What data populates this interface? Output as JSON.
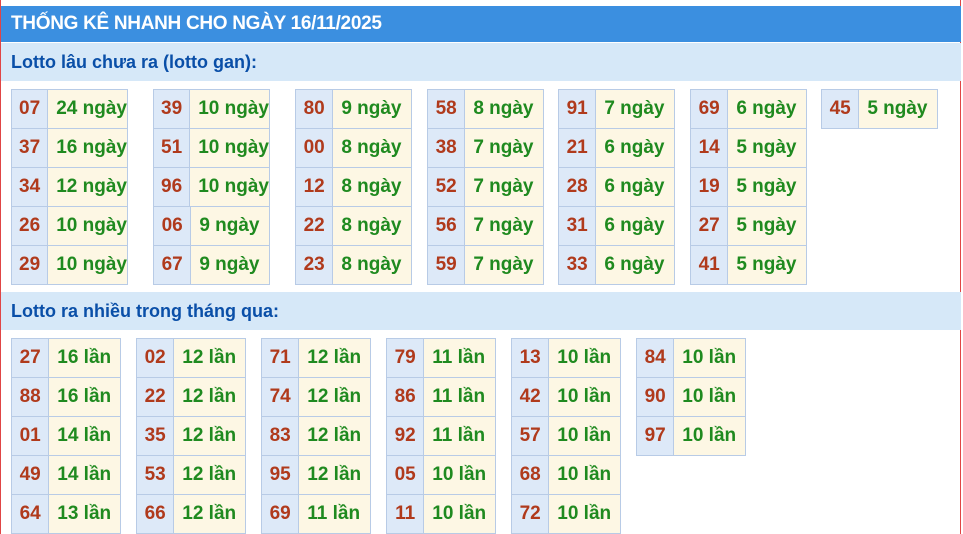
{
  "header": {
    "title": "THỐNG KÊ NHANH CHO NGÀY 16/11/2025"
  },
  "colors": {
    "header_bg": "#3b8fe0",
    "section_bg": "#d6e8f8",
    "number": "#b03a1c",
    "value": "#1f8a1f"
  },
  "lotto_gan": {
    "heading": "Lotto lâu chưa ra (lotto gan):",
    "columns": [
      [
        {
          "number": "07",
          "value": "24 ngày"
        },
        {
          "number": "37",
          "value": "16 ngày"
        },
        {
          "number": "34",
          "value": "12 ngày"
        },
        {
          "number": "26",
          "value": "10 ngày"
        },
        {
          "number": "29",
          "value": "10 ngày"
        }
      ],
      [
        {
          "number": "39",
          "value": "10 ngày"
        },
        {
          "number": "51",
          "value": "10 ngày"
        },
        {
          "number": "96",
          "value": "10 ngày"
        },
        {
          "number": "06",
          "value": "9 ngày"
        },
        {
          "number": "67",
          "value": "9 ngày"
        }
      ],
      [
        {
          "number": "80",
          "value": "9 ngày"
        },
        {
          "number": "00",
          "value": "8 ngày"
        },
        {
          "number": "12",
          "value": "8 ngày"
        },
        {
          "number": "22",
          "value": "8 ngày"
        },
        {
          "number": "23",
          "value": "8 ngày"
        }
      ],
      [
        {
          "number": "58",
          "value": "8 ngày"
        },
        {
          "number": "38",
          "value": "7 ngày"
        },
        {
          "number": "52",
          "value": "7 ngày"
        },
        {
          "number": "56",
          "value": "7 ngày"
        },
        {
          "number": "59",
          "value": "7 ngày"
        }
      ],
      [
        {
          "number": "91",
          "value": "7 ngày"
        },
        {
          "number": "21",
          "value": "6 ngày"
        },
        {
          "number": "28",
          "value": "6 ngày"
        },
        {
          "number": "31",
          "value": "6 ngày"
        },
        {
          "number": "33",
          "value": "6 ngày"
        }
      ],
      [
        {
          "number": "69",
          "value": "6 ngày"
        },
        {
          "number": "14",
          "value": "5 ngày"
        },
        {
          "number": "19",
          "value": "5 ngày"
        },
        {
          "number": "27",
          "value": "5 ngày"
        },
        {
          "number": "41",
          "value": "5 ngày"
        }
      ],
      [
        {
          "number": "45",
          "value": "5 ngày"
        }
      ]
    ]
  },
  "lotto_nhieu": {
    "heading": "Lotto ra nhiều trong tháng qua:",
    "columns": [
      [
        {
          "number": "27",
          "value": "16 lần"
        },
        {
          "number": "88",
          "value": "16 lần"
        },
        {
          "number": "01",
          "value": "14 lần"
        },
        {
          "number": "49",
          "value": "14 lần"
        },
        {
          "number": "64",
          "value": "13 lần"
        }
      ],
      [
        {
          "number": "02",
          "value": "12 lần"
        },
        {
          "number": "22",
          "value": "12 lần"
        },
        {
          "number": "35",
          "value": "12 lần"
        },
        {
          "number": "53",
          "value": "12 lần"
        },
        {
          "number": "66",
          "value": "12 lần"
        }
      ],
      [
        {
          "number": "71",
          "value": "12 lần"
        },
        {
          "number": "74",
          "value": "12 lần"
        },
        {
          "number": "83",
          "value": "12 lần"
        },
        {
          "number": "95",
          "value": "12 lần"
        },
        {
          "number": "69",
          "value": "11 lần"
        }
      ],
      [
        {
          "number": "79",
          "value": "11 lần"
        },
        {
          "number": "86",
          "value": "11 lần"
        },
        {
          "number": "92",
          "value": "11 lần"
        },
        {
          "number": "05",
          "value": "10 lần"
        },
        {
          "number": "11",
          "value": "10 lần"
        }
      ],
      [
        {
          "number": "13",
          "value": "10 lần"
        },
        {
          "number": "42",
          "value": "10 lần"
        },
        {
          "number": "57",
          "value": "10 lần"
        },
        {
          "number": "68",
          "value": "10 lần"
        },
        {
          "number": "72",
          "value": "10 lần"
        }
      ],
      [
        {
          "number": "84",
          "value": "10 lần"
        },
        {
          "number": "90",
          "value": "10 lần"
        },
        {
          "number": "97",
          "value": "10 lần"
        }
      ]
    ]
  }
}
